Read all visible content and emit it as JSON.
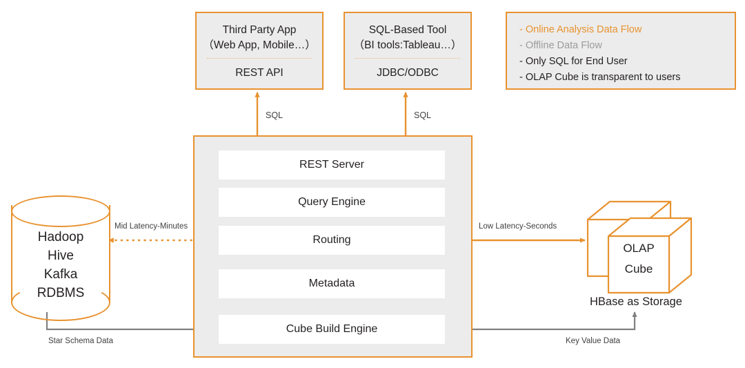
{
  "colors": {
    "orange": "#e8922f",
    "gray": "#808080",
    "gray_text": "#9b9b9b",
    "panel_bg": "#ececec",
    "row_bg": "#ffffff",
    "text": "#231f20"
  },
  "consumers": [
    {
      "title": "Third Party App",
      "subtitle": "（Web App, Mobile…）",
      "protocol": "REST API",
      "arrow_label": "SQL"
    },
    {
      "title": "SQL-Based Tool",
      "subtitle": "（BI tools:Tableau…）",
      "protocol": "JDBC/ODBC",
      "arrow_label": "SQL"
    }
  ],
  "legend": {
    "items": [
      {
        "label": "- Online Analysis Data Flow",
        "style": "orange",
        "arrow": "double-orange"
      },
      {
        "label": "- Offline Data Flow",
        "style": "gray",
        "arrow": "double-gray"
      },
      {
        "label": "- Only SQL for End User",
        "style": "black",
        "arrow": "none"
      },
      {
        "label": "- OLAP Cube is transparent to users",
        "style": "black",
        "arrow": "none"
      }
    ]
  },
  "platform": {
    "components": [
      "REST Server",
      "Query Engine",
      "Routing",
      "Metadata",
      "Cube Build Engine"
    ]
  },
  "source": {
    "lines": [
      "Hadoop",
      "Hive",
      "Kafka",
      "RDBMS"
    ]
  },
  "storage": {
    "cube_lines": [
      "OLAP",
      "Cube"
    ],
    "caption": "HBase  as Storage"
  },
  "connectors": {
    "mid_latency": "Mid Latency-Minutes",
    "low_latency": "Low Latency-Seconds",
    "star_schema": "Star Schema Data",
    "key_value": "Key Value Data"
  }
}
